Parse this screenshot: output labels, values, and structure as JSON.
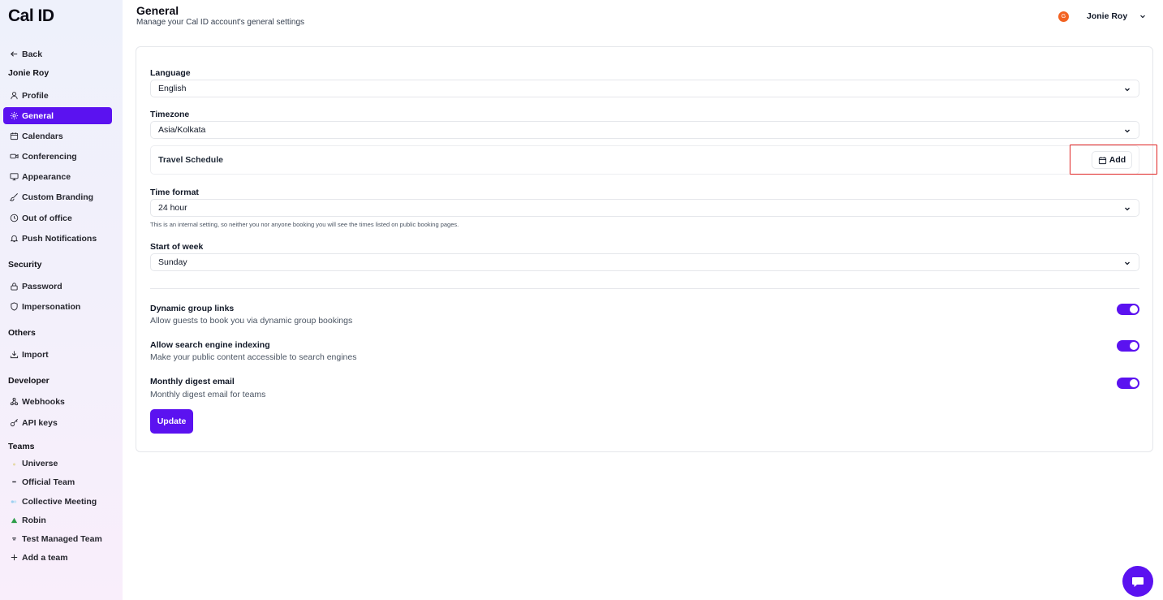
{
  "brand": {
    "logo": "Cal ID"
  },
  "sidebar": {
    "back": "Back",
    "user_heading": "Jonie Roy",
    "account_items": [
      {
        "label": "Profile",
        "icon": "user-icon"
      },
      {
        "label": "General",
        "icon": "gear-icon",
        "active": true
      },
      {
        "label": "Calendars",
        "icon": "calendar-icon"
      },
      {
        "label": "Conferencing",
        "icon": "video-icon"
      },
      {
        "label": "Appearance",
        "icon": "monitor-icon"
      },
      {
        "label": "Custom Branding",
        "icon": "brush-icon"
      },
      {
        "label": "Out of office",
        "icon": "clock-icon"
      },
      {
        "label": "Push Notifications",
        "icon": "bell-icon"
      }
    ],
    "security_heading": "Security",
    "security_items": [
      {
        "label": "Password",
        "icon": "lock-icon"
      },
      {
        "label": "Impersonation",
        "icon": "shield-icon"
      }
    ],
    "others_heading": "Others",
    "others_items": [
      {
        "label": "Import",
        "icon": "download-icon"
      }
    ],
    "developer_heading": "Developer",
    "developer_items": [
      {
        "label": "Webhooks",
        "icon": "webhook-icon"
      },
      {
        "label": "API keys",
        "icon": "key-icon"
      }
    ],
    "teams_heading": "Teams",
    "teams": [
      {
        "label": "Universe",
        "icon": "team-logo-icon"
      },
      {
        "label": "Official Team",
        "icon": "team-logo-icon"
      },
      {
        "label": "Collective Meeting",
        "icon": "team-logo-icon"
      },
      {
        "label": "Robin",
        "icon": "team-logo-icon"
      },
      {
        "label": "Test Managed Team",
        "icon": "team-logo-icon"
      }
    ],
    "add_team": "Add a team"
  },
  "header": {
    "title": "General",
    "subtitle": "Manage your Cal ID account's general settings",
    "user": {
      "avatar_letter": "G",
      "name": "Jonie Roy"
    }
  },
  "form": {
    "language": {
      "label": "Language",
      "value": "English"
    },
    "timezone": {
      "label": "Timezone",
      "value": "Asia/Kolkata"
    },
    "travel_schedule": {
      "label": "Travel Schedule",
      "add_label": "Add"
    },
    "time_format": {
      "label": "Time format",
      "value": "24 hour",
      "hint": "This is an internal setting, so neither you nor anyone booking you will see the times listed on public booking pages."
    },
    "start_of_week": {
      "label": "Start of week",
      "value": "Sunday"
    },
    "toggles": [
      {
        "title": "Dynamic group links",
        "description": "Allow guests to book you via dynamic group bookings",
        "on": true
      },
      {
        "title": "Allow search engine indexing",
        "description": "Make your public content accessible to search engines",
        "on": true
      },
      {
        "title": "Monthly digest email",
        "description": "Monthly digest email for teams",
        "on": true
      }
    ],
    "update_label": "Update"
  },
  "colors": {
    "accent": "#5b12f0",
    "avatar": "#f26322",
    "highlight": "#e02424"
  }
}
